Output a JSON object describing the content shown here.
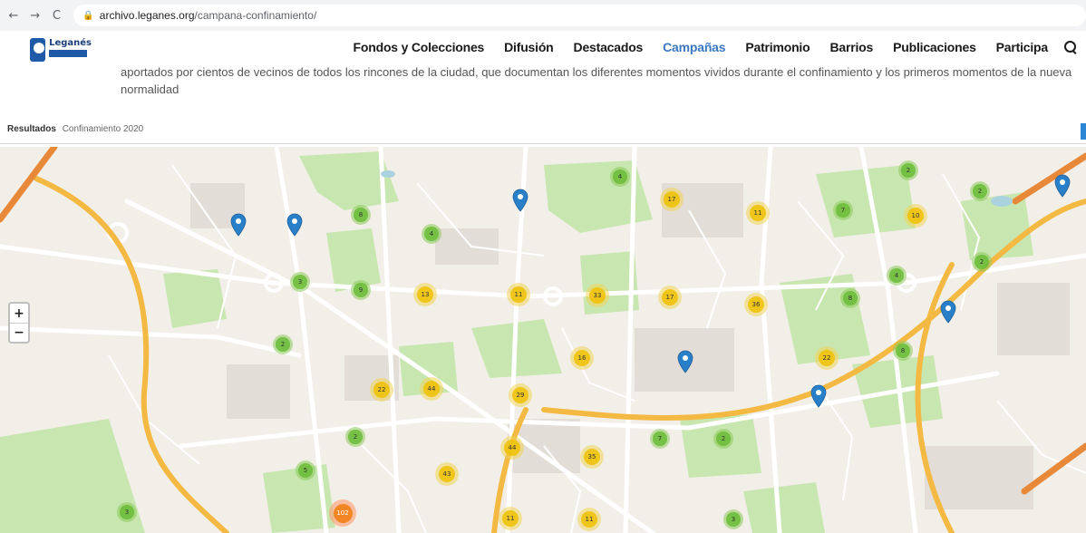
{
  "browser": {
    "back_glyph": "←",
    "forward_glyph": "→",
    "reload_glyph": "C",
    "lock_glyph": "🔒",
    "url_host": "archivo.leganes.org",
    "url_path": "/campana-confinamiento/"
  },
  "header": {
    "logo_name": "Leganés",
    "nav": [
      {
        "label": "Fondos y Colecciones",
        "active": false
      },
      {
        "label": "Difusión",
        "active": false
      },
      {
        "label": "Destacados",
        "active": false
      },
      {
        "label": "Campañas",
        "active": true
      },
      {
        "label": "Patrimonio",
        "active": false
      },
      {
        "label": "Barrios",
        "active": false
      },
      {
        "label": "Publicaciones",
        "active": false
      },
      {
        "label": "Participa",
        "active": false
      }
    ],
    "search_icon": "search-icon",
    "active_color": "#3a78c2"
  },
  "intro": {
    "text": "aportados por cientos de vecinos de todos los rincones de la ciudad, que documentan los diferentes momentos vividos durante el confinamiento y los primeros momentos de la nueva normalidad"
  },
  "results": {
    "label": "Resultados",
    "value": "Confinamiento 2020"
  },
  "map": {
    "zoom_in": "+",
    "zoom_out": "−",
    "pin_color": "#2a7fc9",
    "clusters": [
      {
        "count": "4",
        "size": "small"
      },
      {
        "count": "17",
        "size": "medium"
      },
      {
        "count": "11",
        "size": "medium"
      },
      {
        "count": "2",
        "size": "small"
      },
      {
        "count": "2",
        "size": "small"
      },
      {
        "count": "7",
        "size": "small"
      },
      {
        "count": "10",
        "size": "medium"
      },
      {
        "count": "8",
        "size": "small"
      },
      {
        "count": "4",
        "size": "small"
      },
      {
        "count": "3",
        "size": "small"
      },
      {
        "count": "9",
        "size": "small"
      },
      {
        "count": "13",
        "size": "medium"
      },
      {
        "count": "11",
        "size": "medium"
      },
      {
        "count": "33",
        "size": "medium"
      },
      {
        "count": "17",
        "size": "medium"
      },
      {
        "count": "36",
        "size": "medium"
      },
      {
        "count": "8",
        "size": "small"
      },
      {
        "count": "4",
        "size": "small"
      },
      {
        "count": "2",
        "size": "small"
      },
      {
        "count": "2",
        "size": "small"
      },
      {
        "count": "16",
        "size": "medium"
      },
      {
        "count": "22",
        "size": "medium"
      },
      {
        "count": "8",
        "size": "small"
      },
      {
        "count": "22",
        "size": "medium"
      },
      {
        "count": "44",
        "size": "medium"
      },
      {
        "count": "29",
        "size": "medium"
      },
      {
        "count": "2",
        "size": "small"
      },
      {
        "count": "44",
        "size": "medium"
      },
      {
        "count": "35",
        "size": "medium"
      },
      {
        "count": "7",
        "size": "small"
      },
      {
        "count": "2",
        "size": "small"
      },
      {
        "count": "5",
        "size": "small"
      },
      {
        "count": "43",
        "size": "medium"
      },
      {
        "count": "3",
        "size": "small"
      },
      {
        "count": "102",
        "size": "large"
      },
      {
        "count": "11",
        "size": "medium"
      },
      {
        "count": "11",
        "size": "medium"
      },
      {
        "count": "3",
        "size": "small"
      }
    ]
  }
}
